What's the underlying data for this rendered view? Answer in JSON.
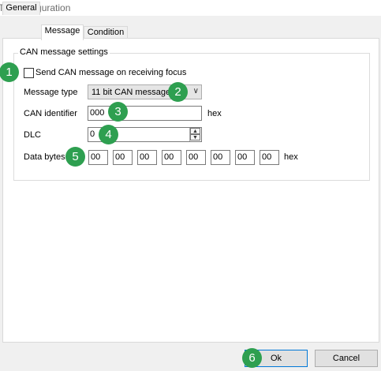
{
  "window": {
    "title": "Tab configuration"
  },
  "tabs": [
    "General",
    "Message",
    "Condition"
  ],
  "group": {
    "title": "CAN message settings"
  },
  "focus_checkbox": {
    "label": "Send CAN message on receiving focus",
    "checked": false
  },
  "message_type": {
    "label": "Message type",
    "value": "11 bit CAN message"
  },
  "can_identifier": {
    "label": "CAN identifier",
    "value": "000",
    "unit": "hex"
  },
  "dlc": {
    "label": "DLC",
    "value": "0"
  },
  "data_bytes": {
    "label": "Data bytes",
    "values": [
      "00",
      "00",
      "00",
      "00",
      "00",
      "00",
      "00",
      "00"
    ],
    "unit": "hex"
  },
  "badges": [
    "1",
    "2",
    "3",
    "4",
    "5",
    "6"
  ],
  "buttons": {
    "ok": "Ok",
    "cancel": "Cancel"
  },
  "colors": {
    "badge": "#2e9f50",
    "ok_border": "#0078d7"
  }
}
